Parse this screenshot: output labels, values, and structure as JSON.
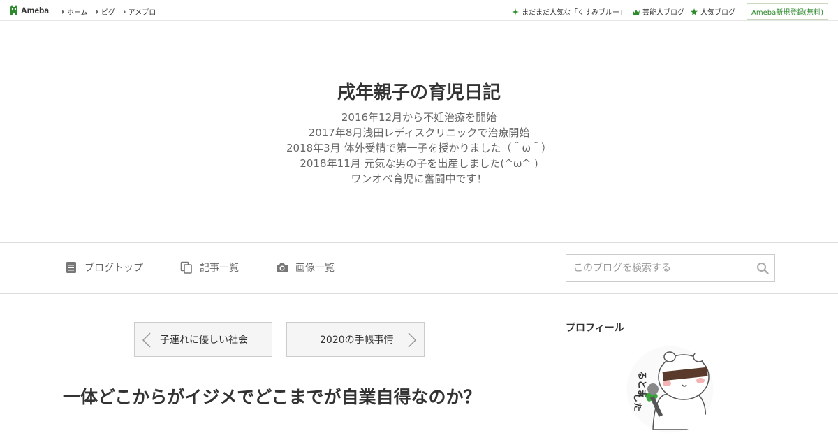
{
  "topbar": {
    "logo_text": "Ameba",
    "nav": [
      {
        "label": "ホーム"
      },
      {
        "label": "ピグ"
      },
      {
        "label": "アメブロ"
      }
    ],
    "right_links": [
      {
        "label": "まだまだ人気な「くすみブルー」",
        "icon": "sparkle-icon"
      },
      {
        "label": "芸能人ブログ",
        "icon": "crown-icon"
      },
      {
        "label": "人気ブログ",
        "icon": "star-icon"
      }
    ],
    "signup_label": "Ameba新規登録(無料)"
  },
  "header": {
    "title": "戌年親子の育児日記",
    "description_lines": [
      "2016年12月から不妊治療を開始",
      "2017年8月浅田レディスクリニックで治療開始",
      "2018年3月 体外受精で第一子を授かりました（＾ω＾）",
      "2018年11月 元気な男の子を出産しました(^ω^ )",
      "ワンオペ育児に奮闘中です！"
    ]
  },
  "navbar": {
    "items": [
      {
        "label": "ブログトップ",
        "icon": "document-icon"
      },
      {
        "label": "記事一覧",
        "icon": "copy-icon"
      },
      {
        "label": "画像一覧",
        "icon": "camera-icon"
      }
    ],
    "search_placeholder": "このブログを検索する"
  },
  "pager": {
    "prev_label": "子連れに優しい社会",
    "next_label": "2020の手帳事情"
  },
  "article": {
    "title": "一体どこからがイジメでどこまでが自業自得なのか？"
  },
  "sidebar": {
    "profile_heading": "プロフィール",
    "avatar_lettering": "るとました"
  },
  "colors": {
    "brand_green": "#2d8a2d",
    "text": "#333333",
    "muted": "#666666"
  }
}
